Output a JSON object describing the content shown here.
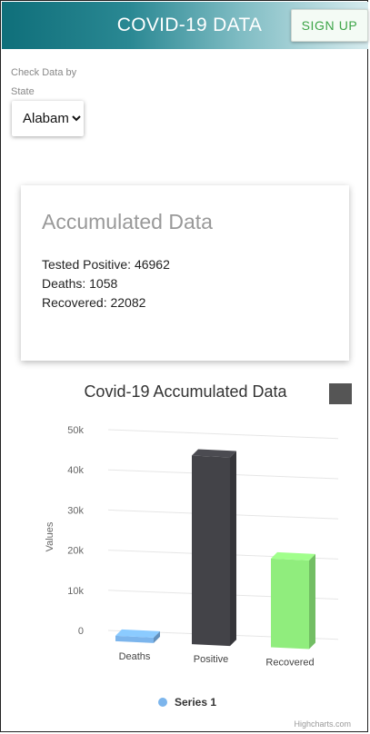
{
  "header": {
    "title": "COVID-19 DATA",
    "signup_label": "SIGN UP"
  },
  "filter": {
    "label_line1": "Check Data by",
    "label_line2": "State",
    "selected_state": "Alabama"
  },
  "summary": {
    "title": "Accumulated Data",
    "tested_positive": "Tested Positive: 46962",
    "deaths": "Deaths: 1058",
    "recovered": "Recovered: 22082"
  },
  "chart_data": {
    "type": "bar",
    "title": "Covid-19 Accumulated Data",
    "ylabel": "Values",
    "categories": [
      "Deaths",
      "Positive",
      "Recovered"
    ],
    "series": [
      {
        "name": "Series 1",
        "values": [
          1058,
          46962,
          22082
        ]
      }
    ],
    "ylim": [
      0,
      50000
    ],
    "yticks": [
      "0",
      "10k",
      "20k",
      "30k",
      "40k",
      "50k"
    ],
    "bar_colors": [
      "#7cb5ec",
      "#434348",
      "#90ed7d"
    ],
    "legend_marker_color": "#7cb5ec",
    "credits": "Highcharts.com",
    "grid": true,
    "legend": "bottom-center"
  },
  "icons": {
    "chart_menu": "hamburger-menu-icon",
    "select_arrow": "chevron-down-icon"
  }
}
